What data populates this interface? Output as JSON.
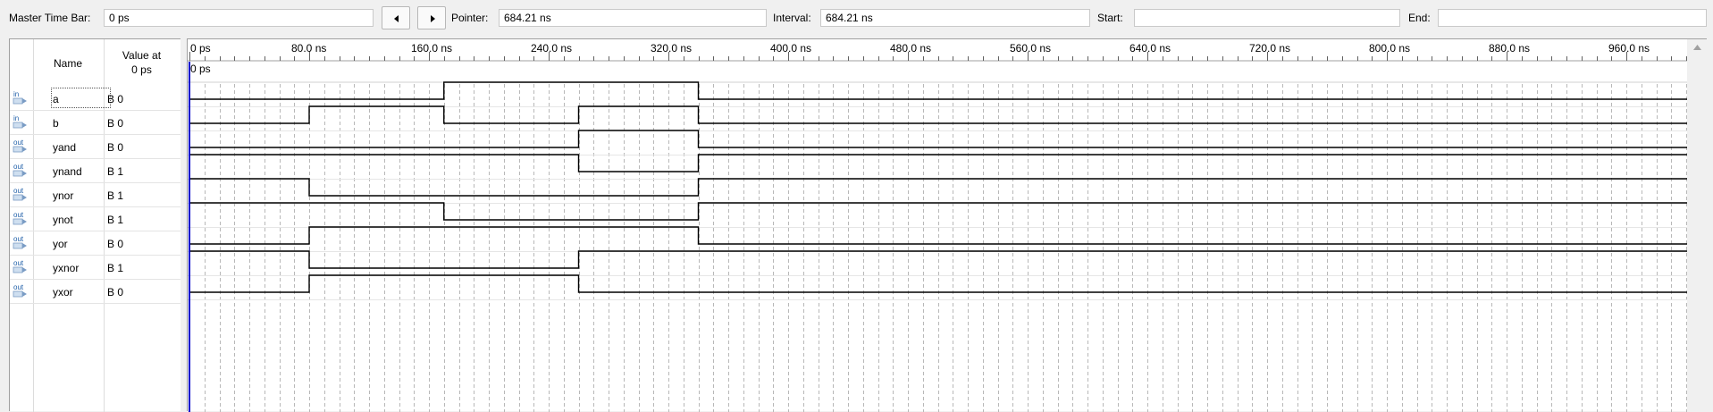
{
  "toolbar": {
    "master_time_bar_label": "Master Time Bar:",
    "master_time_bar_value": "0 ps",
    "prev_icon": "triangle-left-icon",
    "next_icon": "triangle-right-icon",
    "pointer_label": "Pointer:",
    "pointer_value": "684.21 ns",
    "interval_label": "Interval:",
    "interval_value": "684.21 ns",
    "start_label": "Start:",
    "start_value": "",
    "end_label": "End:",
    "end_value": ""
  },
  "columns": {
    "name": "Name",
    "value_line1": "Value at",
    "value_line2": "0 ps"
  },
  "timeline": {
    "ticks": [
      "0 ps",
      "80.0 ns",
      "160.0 ns",
      "240.0 ns",
      "320.0 ns",
      "400.0 ns",
      "480.0 ns",
      "560.0 ns",
      "640.0 ns",
      "720.0 ns",
      "800.0 ns",
      "880.0 ns",
      "960.0 ns"
    ],
    "cursor_label": "0 ps"
  },
  "signals": [
    {
      "name": "a",
      "dir": "in",
      "value": "B 0"
    },
    {
      "name": "b",
      "dir": "in",
      "value": "B 0"
    },
    {
      "name": "yand",
      "dir": "out",
      "value": "B 0"
    },
    {
      "name": "ynand",
      "dir": "out",
      "value": "B 1"
    },
    {
      "name": "ynor",
      "dir": "out",
      "value": "B 1"
    },
    {
      "name": "ynot",
      "dir": "out",
      "value": "B 1"
    },
    {
      "name": "yor",
      "dir": "out",
      "value": "B 0"
    },
    {
      "name": "yxnor",
      "dir": "out",
      "value": "B 1"
    },
    {
      "name": "yxor",
      "dir": "out",
      "value": "B 0"
    }
  ],
  "waveforms_ns": {
    "a": [
      [
        0,
        0
      ],
      [
        170,
        1
      ],
      [
        340,
        0
      ]
    ],
    "b": [
      [
        0,
        0
      ],
      [
        80,
        1
      ],
      [
        170,
        0
      ],
      [
        260,
        1
      ],
      [
        340,
        0
      ]
    ],
    "yand": [
      [
        0,
        0
      ],
      [
        260,
        1
      ],
      [
        340,
        0
      ]
    ],
    "ynand": [
      [
        0,
        1
      ],
      [
        260,
        0
      ],
      [
        340,
        1
      ]
    ],
    "ynor": [
      [
        0,
        1
      ],
      [
        80,
        0
      ],
      [
        340,
        1
      ]
    ],
    "ynot": [
      [
        0,
        1
      ],
      [
        170,
        0
      ],
      [
        340,
        1
      ]
    ],
    "yor": [
      [
        0,
        0
      ],
      [
        80,
        1
      ],
      [
        340,
        0
      ]
    ],
    "yxnor": [
      [
        0,
        1
      ],
      [
        80,
        0
      ],
      [
        260,
        1
      ]
    ],
    "yxor": [
      [
        0,
        0
      ],
      [
        80,
        1
      ],
      [
        260,
        0
      ]
    ]
  },
  "colors": {
    "waveform": "#000000",
    "cursor": "#0000cc",
    "grid": "#b8b8b8",
    "pin_in": "#1f5fa8"
  }
}
